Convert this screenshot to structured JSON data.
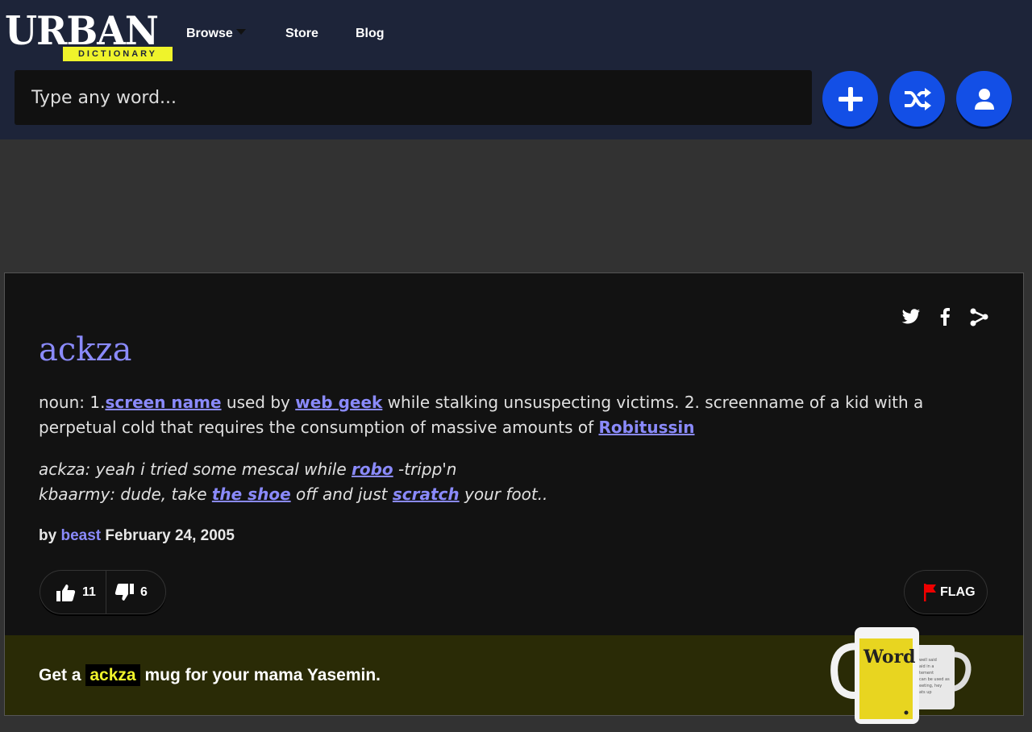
{
  "header": {
    "logo_word": "URBAN",
    "logo_sub": "DICTIONARY",
    "nav": [
      {
        "label": "Browse"
      },
      {
        "label": "Store"
      },
      {
        "label": "Blog"
      }
    ],
    "search_placeholder": "Type any word..."
  },
  "definition": {
    "word": "ackza",
    "meaning": {
      "p1": "noun: 1.",
      "l1": "screen name",
      "p2": " used by ",
      "l2": "web geek",
      "p3": " while stalking unsuspecting victims. 2. screenname of a kid with a perpetual cold that requires the consumption of massive amounts of ",
      "l3": "Robitussin"
    },
    "example": {
      "p1": "ackza: yeah i tried some mescal while ",
      "l1": "robo",
      "p2": " -tripp'n",
      "p3": "kbaarmy: dude, take ",
      "l2": "the shoe",
      "p4": " off and just ",
      "l3": "scratch",
      "p5": " your foot.."
    },
    "by_label": "by",
    "author": "beast",
    "date": "February 24, 2005",
    "upvotes": "11",
    "downvotes": "6",
    "flag_label": "FLAG"
  },
  "promo": {
    "prefix": "Get a",
    "word": "ackza",
    "suffix": "mug for your mama Yasemin.",
    "mug_text": "Word"
  },
  "colors": {
    "header_bg": "#1d2439",
    "accent_blue": "#134fe6",
    "link": "#8a8afb",
    "logo_yellow": "#eff32b",
    "promo_bg": "#2a2b06"
  }
}
